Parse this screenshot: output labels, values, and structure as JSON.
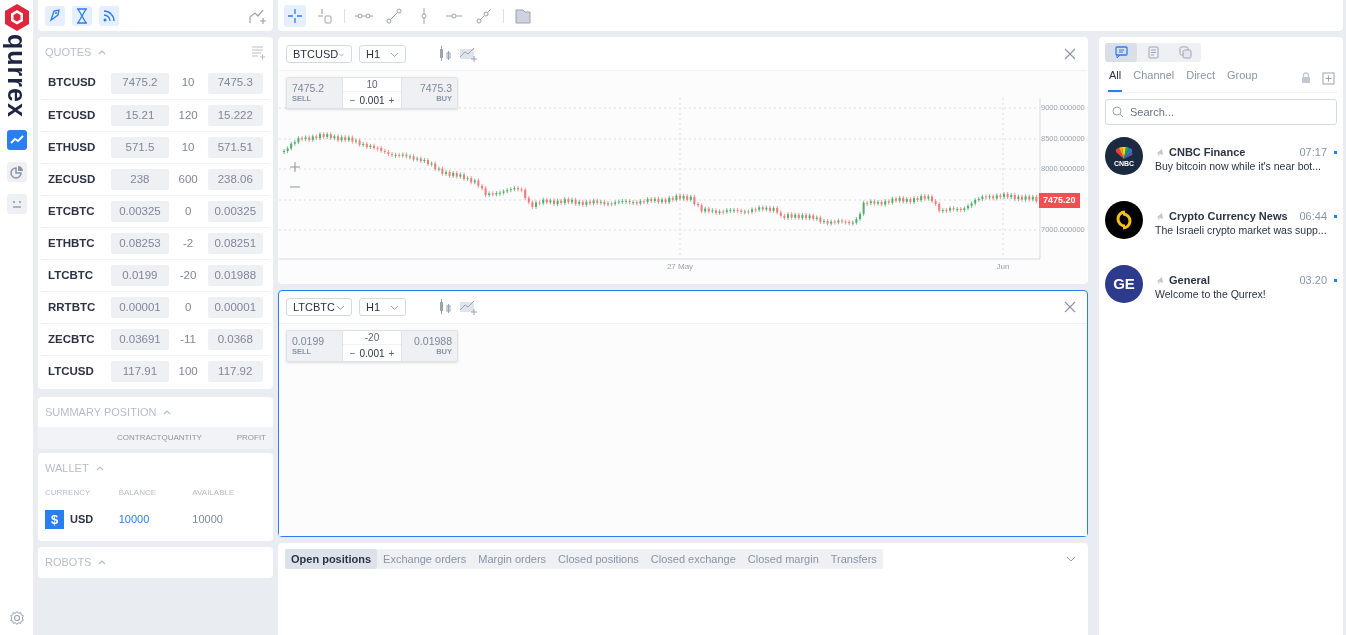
{
  "sidebar": {
    "logo_text": "qurrex",
    "nav": [
      {
        "kind": "chart",
        "selected": true
      },
      {
        "kind": "pie",
        "selected": false
      },
      {
        "kind": "face",
        "selected": false
      }
    ]
  },
  "drawing_tools": [
    {
      "kind": "crosshair",
      "selected": true
    },
    {
      "kind": "cursor-ruler",
      "selected": false
    },
    {
      "kind": "horizontal-segment",
      "selected": false
    },
    {
      "kind": "trend-line",
      "selected": false
    },
    {
      "kind": "vertical-line",
      "selected": false
    },
    {
      "kind": "horizontal-line",
      "selected": false
    },
    {
      "kind": "ray",
      "selected": false
    },
    {
      "kind": "folder",
      "selected": false
    }
  ],
  "quotes": {
    "title": "QUOTES",
    "rows": [
      {
        "symbol": "BTCUSD",
        "bid": "7475.2",
        "quantity": "10",
        "ask": "7475.3"
      },
      {
        "symbol": "ETCUSD",
        "bid": "15.21",
        "quantity": "120",
        "ask": "15.222"
      },
      {
        "symbol": "ETHUSD",
        "bid": "571.5",
        "quantity": "10",
        "ask": "571.51"
      },
      {
        "symbol": "ZECUSD",
        "bid": "238",
        "quantity": "600",
        "ask": "238.06"
      },
      {
        "symbol": "ETCBTC",
        "bid": "0.00325",
        "quantity": "0",
        "ask": "0.00325"
      },
      {
        "symbol": "ETHBTC",
        "bid": "0.08253",
        "quantity": "-2",
        "ask": "0.08251"
      },
      {
        "symbol": "LTCBTC",
        "bid": "0.0199",
        "quantity": "-20",
        "ask": "0.01988"
      },
      {
        "symbol": "RRTBTC",
        "bid": "0.00001",
        "quantity": "0",
        "ask": "0.00001"
      },
      {
        "symbol": "ZECBTC",
        "bid": "0.03691",
        "quantity": "-11",
        "ask": "0.0368"
      },
      {
        "symbol": "LTCUSD",
        "bid": "117.91",
        "quantity": "100",
        "ask": "117.92"
      }
    ]
  },
  "summary_position": {
    "title": "SUMMARY POSITION",
    "columns": [
      "CONTRACT",
      "QUANTITY",
      "PROFIT"
    ]
  },
  "wallet": {
    "title": "WALLET",
    "columns": [
      "CURRENCY",
      "BALANCE",
      "AVAILABLE"
    ],
    "rows": [
      {
        "symbol": "$",
        "currency": "USD",
        "balance": "10000",
        "available": "10000"
      }
    ]
  },
  "robots": {
    "title": "ROBOTS"
  },
  "charts": [
    {
      "symbol": "BTCUSD",
      "timeframe": "H1",
      "focused": false,
      "trade": {
        "sell": "7475.2",
        "sell_label": "SELL",
        "quantity": "10",
        "minus": "−",
        "step": "0.001",
        "plus": "+",
        "buy": "7475.3",
        "buy_label": "BUY"
      },
      "price_chart": {
        "y_labels": [
          "9000.000000",
          "8500.000000",
          "8000.000000",
          "7000.000000"
        ],
        "x_labels": [
          "27 May",
          "Jun"
        ],
        "last_price": "7475.20"
      }
    },
    {
      "symbol": "LTCBTC",
      "timeframe": "H1",
      "focused": true,
      "trade": {
        "sell": "0.0199",
        "sell_label": "SELL",
        "quantity": "-20",
        "minus": "−",
        "step": "0.001",
        "plus": "+",
        "buy": "0.01988",
        "buy_label": "BUY"
      }
    }
  ],
  "bottom_tabs": [
    {
      "label": "Open positions",
      "selected": true
    },
    {
      "label": "Exchange orders",
      "selected": false
    },
    {
      "label": "Margin orders",
      "selected": false
    },
    {
      "label": "Closed positions",
      "selected": false
    },
    {
      "label": "Closed exchange",
      "selected": false
    },
    {
      "label": "Closed margin",
      "selected": false
    },
    {
      "label": "Transfers",
      "selected": false
    }
  ],
  "chat": {
    "view_tabs": [
      {
        "kind": "chat",
        "selected": true
      },
      {
        "kind": "document",
        "selected": false
      },
      {
        "kind": "copy",
        "selected": false
      }
    ],
    "filters": [
      {
        "label": "All",
        "selected": true
      },
      {
        "label": "Channel",
        "selected": false
      },
      {
        "label": "Direct",
        "selected": false
      },
      {
        "label": "Group",
        "selected": false
      }
    ],
    "search": {
      "placeholder": "Search..."
    },
    "conversations": [
      {
        "avatar": {
          "kind": "cnbc",
          "text": "CNBC"
        },
        "name": "CNBC Finance",
        "time": "07:17",
        "preview": "Buy bitcoin now while it's near bot...",
        "unread": true
      },
      {
        "avatar": {
          "kind": "coin"
        },
        "name": "Crypto Currency News",
        "time": "06:44",
        "preview": "The Israeli crypto market was supp...",
        "unread": true
      },
      {
        "avatar": {
          "kind": "initials",
          "text": "GE",
          "color": "#2e3a8c"
        },
        "name": "General",
        "time": "03.20",
        "preview": "Welcome to the Qurrex!",
        "unread": true
      }
    ]
  }
}
